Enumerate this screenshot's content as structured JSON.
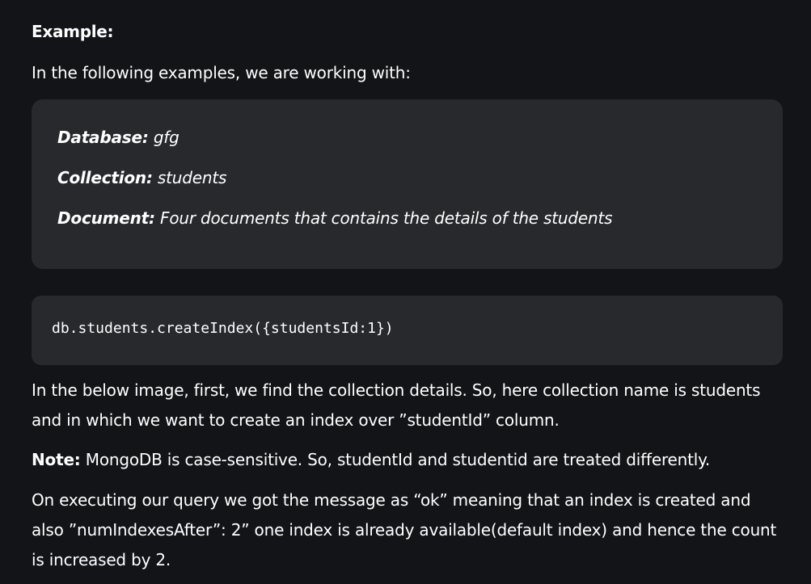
{
  "heading": "Example:",
  "intro": "In the following examples, we are working with:",
  "info": {
    "database_key": "Database:",
    "database_value": "gfg",
    "collection_key": "Collection:",
    "collection_value": "students",
    "document_key": "Document:",
    "document_value": "Four documents that contains the details of the students"
  },
  "code": "db.students.createIndex({studentsId:1})",
  "below_text": "In the below image, first, we find the collection details. So, here collection name is students and in which we want to create an index over ”studentId” column.",
  "note": {
    "label": "Note:",
    "text": "MongoDB is case-sensitive. So, studentId and studentid are treated differently."
  },
  "exec_text": "On executing our query we got the message as “ok” meaning that an index is created and also ”numIndexesAfter”: 2” one index is already available(default index) and hence the count is increased by 2."
}
